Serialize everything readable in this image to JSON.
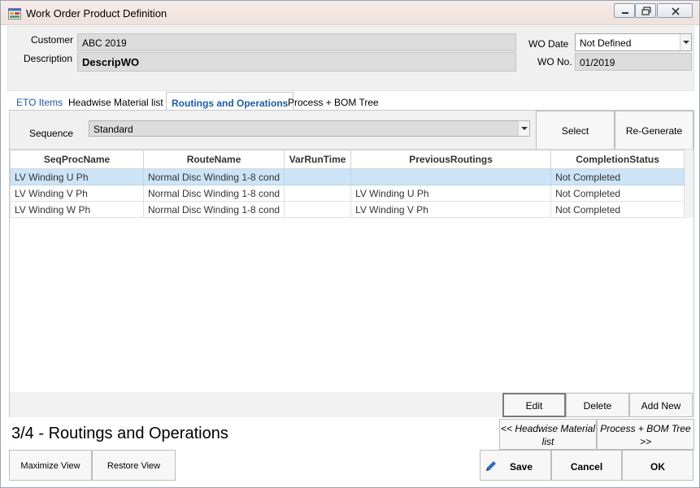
{
  "window": {
    "title": "Work Order Product Definition"
  },
  "header": {
    "customer_label": "Customer",
    "customer_value": "ABC 2019",
    "description_label": "Description",
    "description_value": "DescripWO",
    "wo_date_label": "WO Date",
    "wo_date_value": "Not Defined",
    "wo_no_label": "WO No.",
    "wo_no_value": "01/2019"
  },
  "tabs": [
    {
      "label": "ETO Items"
    },
    {
      "label": "Headwise Material list"
    },
    {
      "label": "Routings and Operations",
      "active": true
    },
    {
      "label": "Process + BOM Tree"
    }
  ],
  "sequence": {
    "label": "Sequence",
    "value": "Standard"
  },
  "top_buttons": {
    "select": "Select",
    "regenerate": "Re-Generate"
  },
  "grid": {
    "columns": [
      "SeqProcName",
      "RouteName",
      "VarRunTime",
      "PreviousRoutings",
      "CompletionStatus"
    ],
    "rows": [
      [
        "LV Winding U Ph",
        "Normal Disc Winding 1-8 cond",
        "",
        "",
        "Not Completed"
      ],
      [
        "LV Winding V Ph",
        "Normal Disc Winding 1-8 cond",
        "",
        "LV Winding U Ph",
        "Not Completed"
      ],
      [
        "LV Winding W Ph",
        "Normal Disc Winding 1-8 cond",
        "",
        "LV Winding V Ph",
        "Not Completed"
      ]
    ],
    "selected_row": 0
  },
  "grid_buttons": {
    "edit": "Edit",
    "delete": "Delete",
    "add_new": "Add New"
  },
  "status": {
    "step_text": "3/4 - Routings and Operations"
  },
  "nav": {
    "prev_label": "<< Headwise Material list",
    "next_label": "Process + BOM Tree >>"
  },
  "footer": {
    "maximize": "Maximize View",
    "restore": "Restore View",
    "save": "Save",
    "cancel": "Cancel",
    "ok": "OK"
  },
  "colors": {
    "selected_row": "#cde4f7",
    "tab_active": "#1e5aa8"
  },
  "icons": {
    "app": "app-form-icon",
    "save": "pencil-icon"
  }
}
